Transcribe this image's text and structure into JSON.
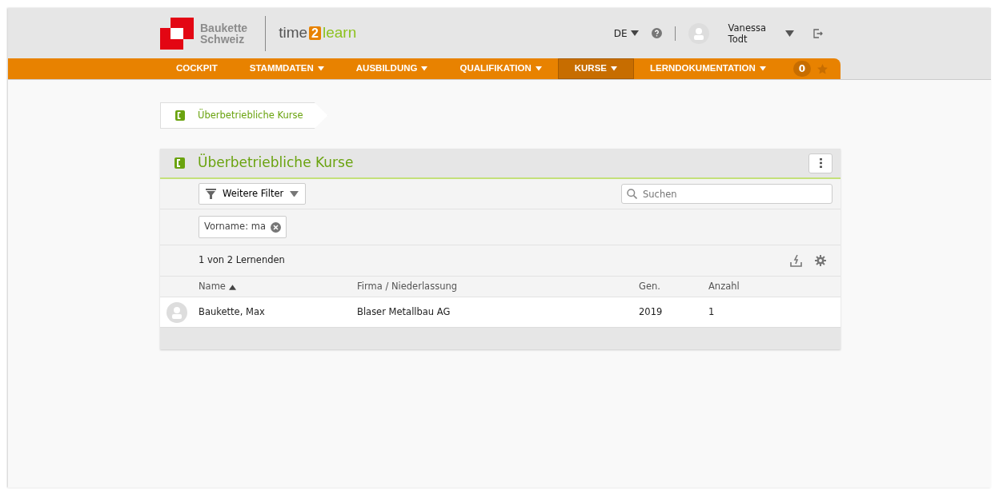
{
  "header": {
    "company_lines": [
      "Baukette",
      "Schweiz"
    ],
    "app_logo": {
      "before": "time",
      "badge": "2",
      "after": "learn"
    },
    "language": "DE",
    "user_lines": [
      "Vanessa",
      "Todt"
    ]
  },
  "nav": {
    "items": [
      {
        "label": "COCKPIT",
        "dropdown": false,
        "selected": false
      },
      {
        "label": "STAMMDATEN",
        "dropdown": true,
        "selected": false
      },
      {
        "label": "AUSBILDUNG",
        "dropdown": true,
        "selected": false
      },
      {
        "label": "QUALIFIKATION",
        "dropdown": true,
        "selected": false
      },
      {
        "label": "KURSE",
        "dropdown": true,
        "selected": true
      },
      {
        "label": "LERNDOKUMENTATION",
        "dropdown": true,
        "selected": false
      }
    ],
    "badge": "0"
  },
  "breadcrumb": [
    "Überbetriebliche Kurse"
  ],
  "panel": {
    "title": "Überbetriebliche Kurse",
    "filter_button": "Weitere Filter",
    "search": {
      "placeholder": "Suchen"
    },
    "filter_chips": [
      "Vorname: ma"
    ],
    "count": "1 von 2 Lernenden",
    "table": {
      "columns": [
        {
          "label": "Name",
          "sorted": true
        },
        {
          "label": "Firma / Niederlassung",
          "sorted": false
        },
        {
          "label": "Gen.",
          "sorted": false
        },
        {
          "label": "Anzahl",
          "sorted": false
        }
      ],
      "rows": [
        {
          "cells": [
            "Baukette, Max",
            "Blaser Metallbau AG",
            "2019",
            "1"
          ]
        }
      ]
    }
  }
}
